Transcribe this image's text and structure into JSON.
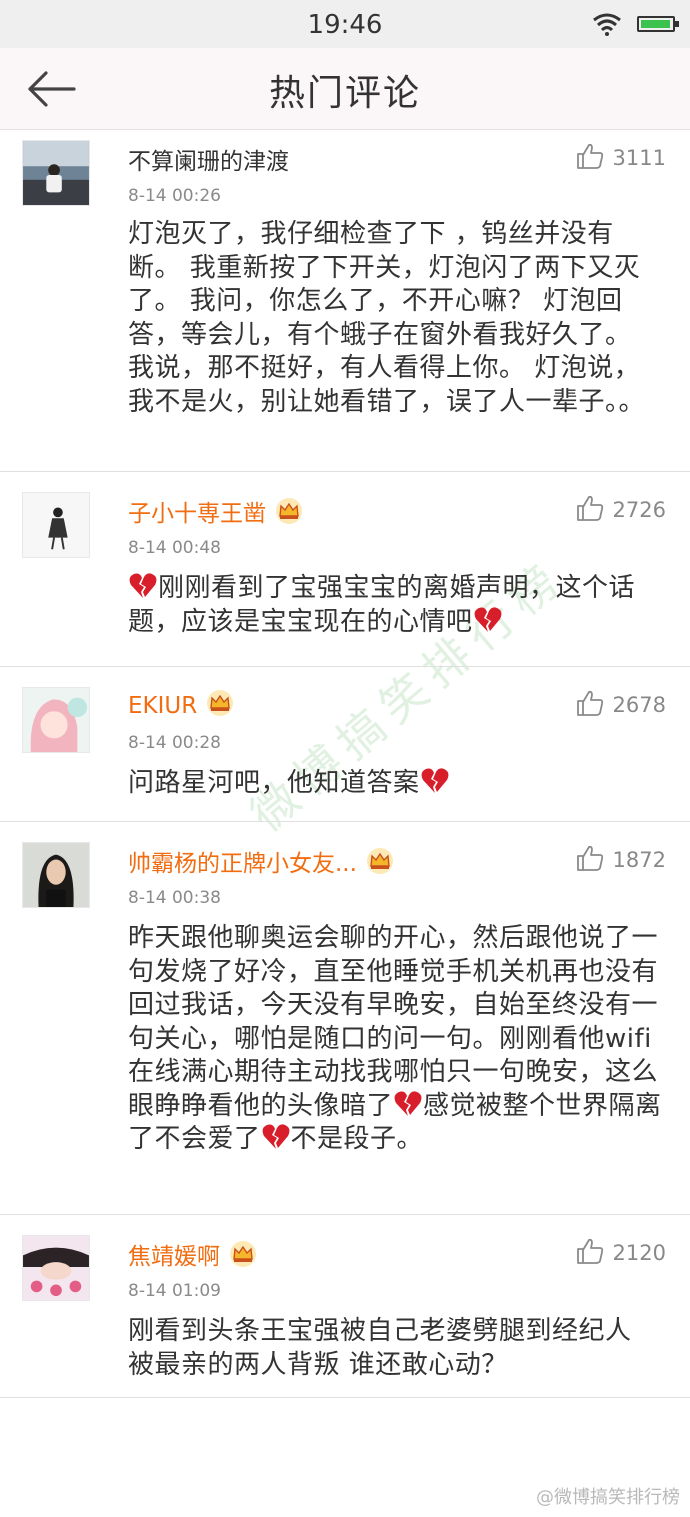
{
  "status_bar": {
    "time": "19:46",
    "battery_level": 0.95
  },
  "nav": {
    "title": "热门评论"
  },
  "comments": [
    {
      "username": "不算阑珊的津渡",
      "vip": false,
      "time": "8-14 00:26",
      "likes": "3111",
      "avatar_icon": "boy-by-water-avatar",
      "segments": [
        "灯泡灭了，我仔细检查了下 ，钨丝并没有断。 我重新按了下开关，灯泡闪了两下又灭了。 我问，你怎么了，不开心嘛？ 灯泡回答，等会儿，有个蛾子在窗外看我好久了。 我说，那不挺好，有人看得上你。 灯泡说，我不是火，别让她看错了，误了人一辈子。。"
      ]
    },
    {
      "username": "子小十専王凿",
      "vip": true,
      "time": "8-14 00:48",
      "likes": "2726",
      "avatar_icon": "girl-sketch-avatar",
      "segments": [
        "",
        "刚刚看到了宝强宝宝的离婚声明，这个话题，应该是宝宝现在的心情吧",
        ""
      ]
    },
    {
      "username": "EKIUR",
      "vip": true,
      "time": "8-14 00:28",
      "likes": "2678",
      "avatar_icon": "anime-girl-avatar",
      "segments": [
        "问路星河吧，他知道答案",
        ""
      ]
    },
    {
      "username": "帅霸杨的正牌小女友...",
      "vip": true,
      "time": "8-14 00:38",
      "likes": "1872",
      "avatar_icon": "girl-photo-avatar",
      "segments": [
        "昨天跟他聊奥运会聊的开心，然后跟他说了一句发烧了好冷，直至他睡觉手机关机再也没有回过我话，今天没有早晚安，自始至终没有一句关心，哪怕是随口的问一句。刚刚看他wifi在线满心期待主动找我哪怕只一句晚安，这么眼睁睁看他的头像暗了",
        "",
        "感觉被整个世界隔离了不会爱了",
        "",
        "不是段子。"
      ]
    },
    {
      "username": "焦靖媛啊",
      "vip": true,
      "time": "8-14 01:09",
      "likes": "2120",
      "avatar_icon": "sleeping-girl-avatar",
      "segments": [
        "刚看到头条王宝强被自己老婆劈腿到经纪人 被最亲的两人背叛 谁还敢心动？"
      ]
    }
  ],
  "watermark": "微博搞笑排行榜",
  "footer_watermark": "@微博搞笑排行榜",
  "colors": {
    "vip_name": "#f16d12",
    "heart": "#d81e2a",
    "crown": "#f5b62a"
  }
}
